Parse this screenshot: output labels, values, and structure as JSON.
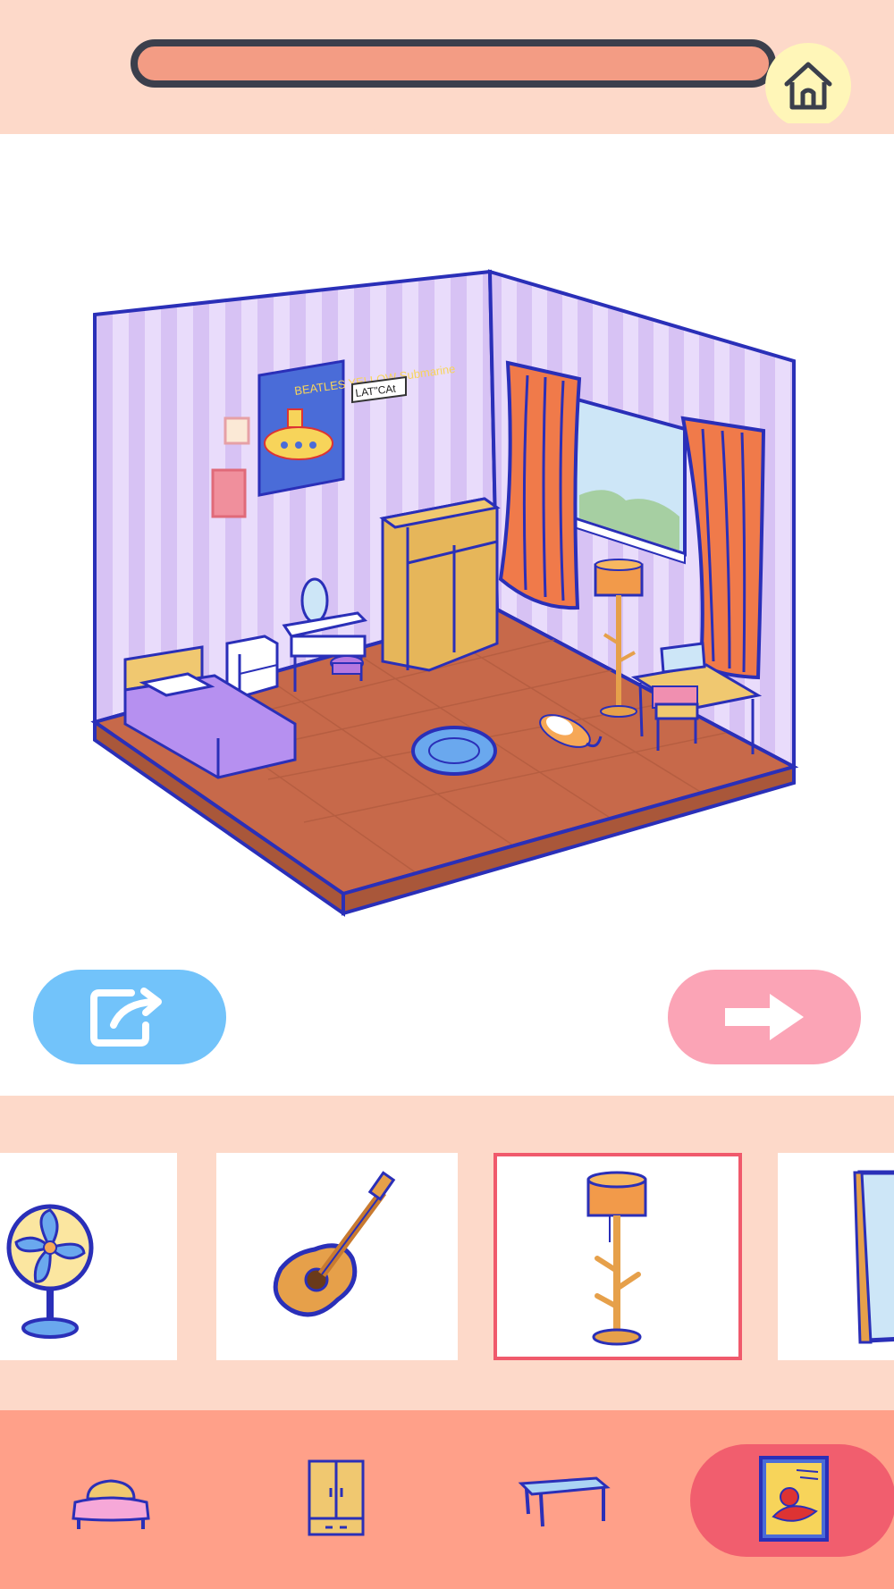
{
  "header": {
    "progress_value": 1.0,
    "home_icon": "house-icon"
  },
  "room": {
    "poster_text": "BEATLES YELLOW Submarine",
    "sign_text": "LAT\"CAt"
  },
  "actions": {
    "share_icon": "share-icon",
    "next_icon": "arrow-right-icon"
  },
  "tray": {
    "items": [
      {
        "name": "fan"
      },
      {
        "name": "guitar"
      },
      {
        "name": "floor-lamp-coat-rack",
        "selected": true
      },
      {
        "name": "mirror"
      }
    ]
  },
  "tabs": [
    {
      "name": "bed",
      "active": false
    },
    {
      "name": "wardrobe",
      "active": false
    },
    {
      "name": "table",
      "active": false
    },
    {
      "name": "poster",
      "active": true
    }
  ],
  "colors": {
    "header_bg": "#fdd9c9",
    "progress_fill": "#f39c84",
    "share_button": "#72c3fa",
    "next_button": "#fba4b6",
    "tab_bar": "#ffa089",
    "tab_active": "#f15e6e",
    "selected_border": "#f05a6c"
  }
}
